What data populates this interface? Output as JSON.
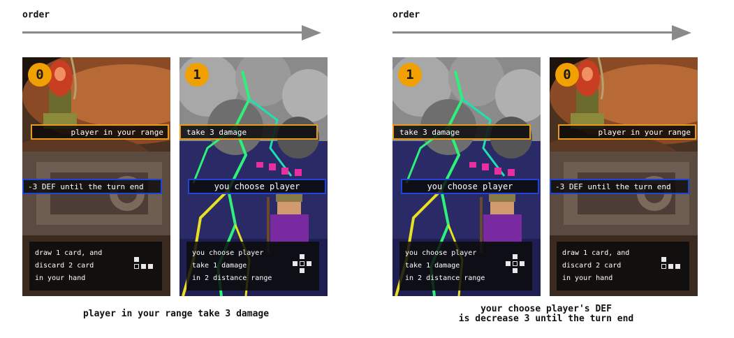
{
  "panels": [
    {
      "order_label": "order",
      "caption_lines": [
        "player in your range take 3 damage"
      ],
      "cards": [
        {
          "number": "0",
          "theme": "altar",
          "orange_text": "player in your range",
          "blue_text": "-3 DEF until the turn end",
          "effect_lines": [
            "draw 1 card, and",
            "discard 2 card",
            "in your hand"
          ],
          "range_pattern": "line"
        },
        {
          "number": "1",
          "theme": "lightning",
          "orange_text": "take 3 damage",
          "blue_text": "you choose player",
          "effect_lines": [
            "you choose player",
            "take 1 damage",
            "in 2 distance range"
          ],
          "range_pattern": "cross"
        }
      ]
    },
    {
      "order_label": "order",
      "caption_lines": [
        "your choose player's DEF",
        "is decrease 3 until the turn end"
      ],
      "cards": [
        {
          "number": "1",
          "theme": "lightning",
          "orange_text": "take 3 damage",
          "blue_text": "you choose player",
          "effect_lines": [
            "you choose player",
            "take 1 damage",
            "in 2 distance range"
          ],
          "range_pattern": "cross"
        },
        {
          "number": "0",
          "theme": "altar",
          "orange_text": "player in your range",
          "blue_text": "-3 DEF until the turn end",
          "effect_lines": [
            "draw 1 card, and",
            "discard 2 card",
            "in your hand"
          ],
          "range_pattern": "line"
        }
      ]
    }
  ],
  "colors": {
    "orange_border": "#e89a1c",
    "blue_border": "#1e44d8",
    "badge": "#f0a000",
    "arrow": "#8a8a8a"
  }
}
